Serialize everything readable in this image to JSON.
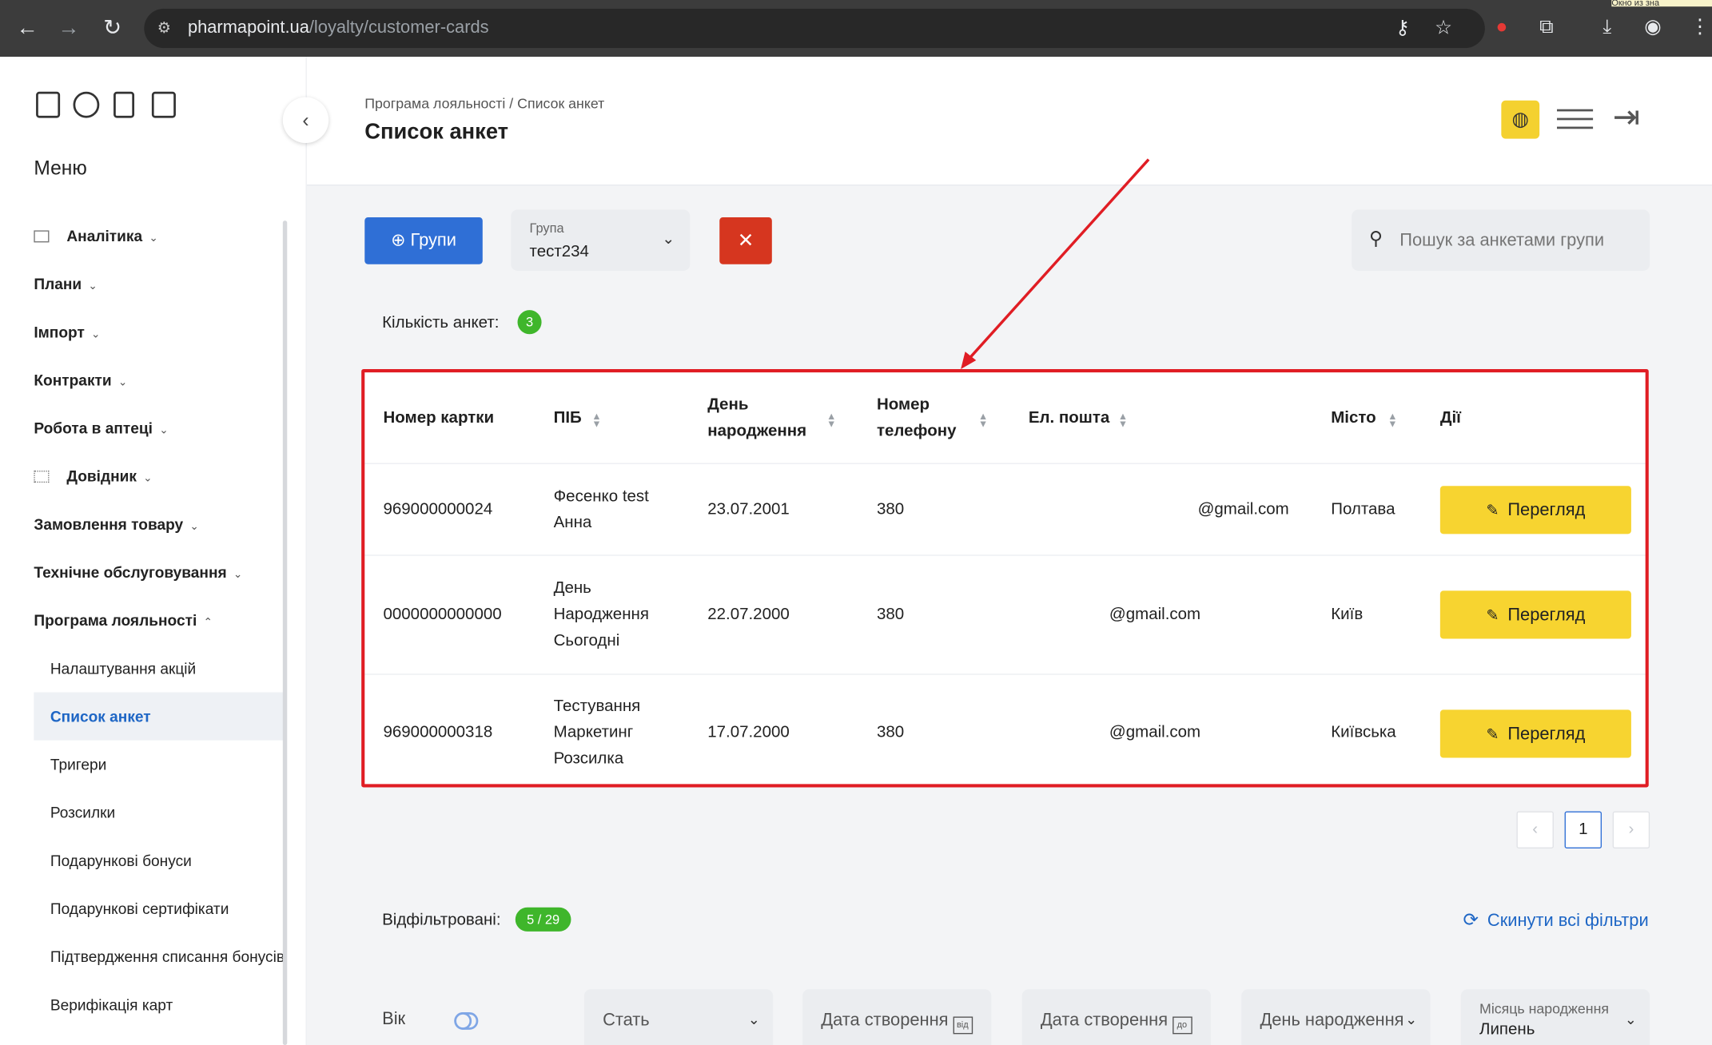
{
  "browser": {
    "url_host": "pharmapoint.ua",
    "url_path": "/loyalty/customer-cards",
    "tooltip_fragment": "Окно из зна"
  },
  "sidebar": {
    "menu_title": "Меню",
    "items": [
      {
        "label": "Аналітика",
        "icon": "grid-icon"
      },
      {
        "label": "Плани"
      },
      {
        "label": "Імпорт"
      },
      {
        "label": "Контракти"
      },
      {
        "label": "Робота в аптеці"
      },
      {
        "label": "Довідник",
        "icon": "list-icon"
      },
      {
        "label": "Замовлення товару"
      },
      {
        "label": "Технічне обслуговування"
      },
      {
        "label": "Програма лояльності"
      }
    ],
    "subitems": [
      "Налаштування акцій",
      "Список анкет",
      "Тригери",
      "Розсилки",
      "Подарункові бонуси",
      "Подарункові сертифікати",
      "Підтвердження списання бонусів",
      "Верифікація карт"
    ]
  },
  "header": {
    "breadcrumb": "Програма лояльності / Список анкет",
    "title": "Список анкет"
  },
  "toolbar": {
    "groups_label": "Групи",
    "group_select_label": "Група",
    "group_select_value": "тест234",
    "search_placeholder": "Пошук за анкетами групи"
  },
  "count": {
    "label": "Кількість анкет:",
    "value": "3"
  },
  "table": {
    "headers": {
      "card": "Номер картки",
      "name": "ПІБ",
      "birthday_1": "День",
      "birthday_2": "народження",
      "phone_1": "Номер",
      "phone_2": "телефону",
      "email": "Ел. пошта",
      "city": "Місто",
      "actions": "Дії"
    },
    "rows": [
      {
        "card": "969000000024",
        "name_1": "Фесенко test",
        "name_2": "Анна",
        "name_3": "",
        "birthday": "23.07.2001",
        "phone": "380",
        "email": "@gmail.com",
        "city": "Полтава",
        "action": "Перегляд"
      },
      {
        "card": "0000000000000",
        "name_1": "День",
        "name_2": "Народження",
        "name_3": "Сьогодні",
        "birthday": "22.07.2000",
        "phone": "380",
        "email": "@gmail.com",
        "city": "Київ",
        "action": "Перегляд"
      },
      {
        "card": "969000000318",
        "name_1": "Тестування",
        "name_2": "Маркетинг",
        "name_3": "Розсилка",
        "birthday": "17.07.2000",
        "phone": "380",
        "email": "@gmail.com",
        "city": "Київська",
        "action": "Перегляд"
      }
    ]
  },
  "pagination": {
    "prev": "‹",
    "current": "1",
    "next": "›"
  },
  "filtered": {
    "label": "Відфільтровані:",
    "value": "5 / 29",
    "reset_label": "Скинути всі фільтри"
  },
  "filters": {
    "age_label": "Вік",
    "gender": "Стать",
    "created_from": "Дата створення",
    "created_from_tag": "від",
    "created_to": "Дата створення",
    "created_to_tag": "до",
    "birthday": "День народження",
    "birth_month_label": "Місяць народження",
    "birth_month_value": "Липень"
  },
  "colors": {
    "primary": "#2f6fd6",
    "danger": "#d6361f",
    "accent": "#f7d430",
    "success": "#3fb62b",
    "annotation": "#e01d24"
  }
}
